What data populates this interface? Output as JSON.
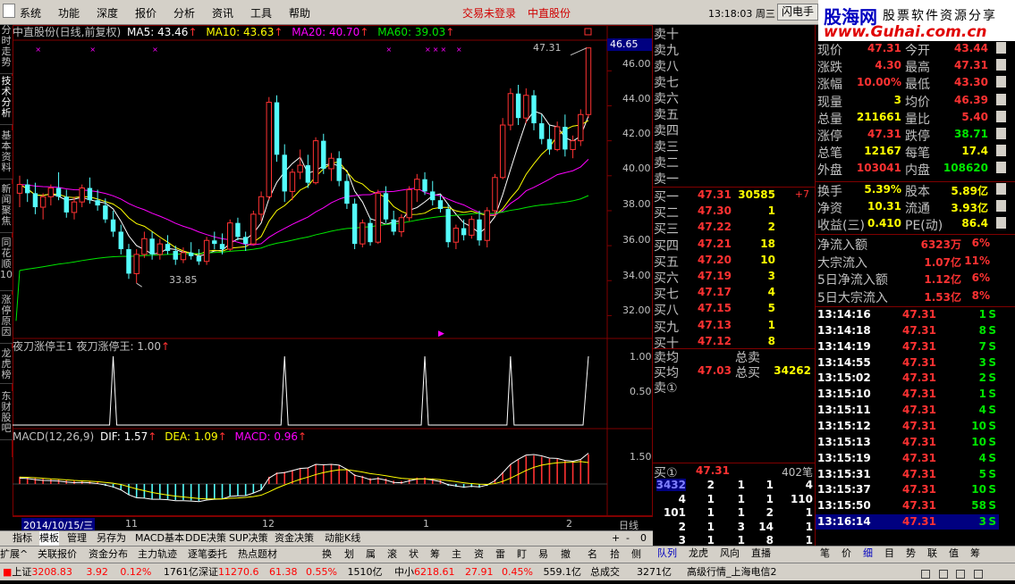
{
  "menu": {
    "items": [
      "系统",
      "功能",
      "深度",
      "报价",
      "分析",
      "资讯",
      "工具",
      "帮助"
    ],
    "status": "交易未登录",
    "stock_title": "中直股份",
    "time": "13:18:03 周三",
    "flash_btn": "闪电手"
  },
  "banner": {
    "logo_text": "股海网",
    "url": "www.Guhai.com.cn",
    "slogan": "股票软件资源分享"
  },
  "side_tabs": [
    "分时走势",
    "技术分析",
    "基本资料",
    "新闻聚焦",
    "同花顺10",
    "涨停原因",
    "龙虎榜",
    "东财股吧"
  ],
  "chart": {
    "header": {
      "name": "中直股份(日线,前复权)",
      "ma5": "MA5: 43.46",
      "ma10": "MA10: 43.63",
      "ma20": "MA20: 40.70",
      "ma60": "MA60: 39.03"
    },
    "price_axis": [
      "46.00",
      "44.00",
      "42.00",
      "40.00",
      "38.00",
      "36.00",
      "34.00",
      "32.00"
    ],
    "current_price_tag": "46.65",
    "high_label": "47.31",
    "low_label": "33.85",
    "ind1_header": "夜刀涨停王1  夜刀涨停王: 1.00",
    "ind1_axis": [
      "1.00",
      "0.50"
    ],
    "macd_header": {
      "name": "MACD(12,26,9)",
      "dif": "DIF: 1.57",
      "dea": "DEA: 1.09",
      "macd": "MACD: 0.96"
    },
    "macd_axis": [
      "1.50"
    ],
    "date_cursor": "2014/10/15/三",
    "months": [
      "11",
      "12",
      "1",
      "2"
    ],
    "period": "日线",
    "candles": [
      [
        39,
        40,
        38.2,
        39.5
      ],
      [
        39.5,
        39.8,
        38.5,
        39
      ],
      [
        39,
        39.6,
        37.8,
        38.2
      ],
      [
        38.2,
        39,
        37.5,
        38.8
      ],
      [
        38.8,
        39.5,
        38.3,
        39.3
      ],
      [
        39.3,
        40.2,
        38.6,
        38.8
      ],
      [
        38.8,
        39.2,
        37.6,
        37.9
      ],
      [
        37.9,
        38.8,
        37.5,
        38.5
      ],
      [
        38.5,
        39.5,
        38.2,
        39.3
      ],
      [
        39.3,
        39.9,
        38.4,
        38.6
      ],
      [
        38.6,
        39.2,
        38,
        38.3
      ],
      [
        38.3,
        38.7,
        37.3,
        37.5
      ],
      [
        37.5,
        38,
        36.5,
        36.8
      ],
      [
        36.8,
        37.2,
        35.5,
        35.8
      ],
      [
        35.8,
        36.1,
        34.1,
        34.4
      ],
      [
        34.4,
        35.8,
        33.85,
        35.5
      ],
      [
        35.5,
        36.8,
        35.3,
        36.4
      ],
      [
        36.4,
        36.8,
        35.2,
        35.5
      ],
      [
        35.5,
        36.4,
        35.2,
        36.1
      ],
      [
        36.1,
        36.6,
        35.5,
        35.7
      ],
      [
        35.7,
        36,
        34.9,
        35.2
      ],
      [
        35.2,
        35.9,
        35,
        35.6
      ],
      [
        35.6,
        36.2,
        35.2,
        35.4
      ],
      [
        35.4,
        35.8,
        34.9,
        35.1
      ],
      [
        35.1,
        36.5,
        34.9,
        36.3
      ],
      [
        36.3,
        36.8,
        35.8,
        36.1
      ],
      [
        36.1,
        36.7,
        35.5,
        35.8
      ],
      [
        35.8,
        37.5,
        35.7,
        37.3
      ],
      [
        37.3,
        37.6,
        36.3,
        36.5
      ],
      [
        36.5,
        36.8,
        35.7,
        36.1
      ],
      [
        36.1,
        38,
        36,
        37.8
      ],
      [
        37.8,
        39.1,
        37.4,
        38.8
      ],
      [
        38.8,
        44.5,
        38.6,
        44.2
      ],
      [
        44.2,
        44.6,
        40.8,
        41.2
      ],
      [
        41.2,
        41.8,
        38.5,
        39.1
      ],
      [
        39.1,
        40.4,
        38.6,
        40.2
      ],
      [
        40.2,
        41.5,
        39.8,
        40.6
      ],
      [
        40.6,
        41.2,
        39.3,
        39.6
      ],
      [
        39.6,
        42.2,
        39.5,
        42
      ],
      [
        42,
        42.4,
        40.1,
        40.4
      ],
      [
        40.4,
        41.3,
        39.7,
        41
      ],
      [
        41,
        41.4,
        39.4,
        39.7
      ],
      [
        39.7,
        40.1,
        38.1,
        38.4
      ],
      [
        38.4,
        38.7,
        35.8,
        36.1
      ],
      [
        36.1,
        37.5,
        35.9,
        37.3
      ],
      [
        37.3,
        37.6,
        36,
        36.2
      ],
      [
        36.2,
        39.2,
        36.1,
        39
      ],
      [
        39,
        39.4,
        37.3,
        37.5
      ],
      [
        37.5,
        38,
        36.6,
        36.8
      ],
      [
        36.8,
        37.8,
        36.5,
        37.6
      ],
      [
        37.6,
        39.4,
        37.4,
        39.2
      ],
      [
        39.2,
        40.1,
        38.5,
        39.8
      ],
      [
        39.8,
        40.2,
        38.9,
        39.1
      ],
      [
        39.1,
        39.7,
        38.3,
        38.6
      ],
      [
        38.6,
        38.9,
        37.9,
        38.1
      ],
      [
        38.1,
        38.4,
        35.9,
        36.2
      ],
      [
        36.2,
        37.2,
        35.8,
        37
      ],
      [
        37,
        37.5,
        36.3,
        36.6
      ],
      [
        36.6,
        37.7,
        36.4,
        37.5
      ],
      [
        37.5,
        38,
        36,
        36.3
      ],
      [
        36.3,
        38.2,
        35.9,
        38
      ],
      [
        38,
        40.1,
        37.7,
        39.9
      ],
      [
        39.9,
        43.3,
        39.8,
        42.9
      ],
      [
        42.9,
        45,
        42.6,
        44.7
      ],
      [
        44.7,
        45.2,
        42.9,
        43.3
      ],
      [
        43.3,
        45,
        43,
        44.6
      ],
      [
        44.6,
        44.9,
        42.6,
        43
      ],
      [
        43,
        43.5,
        41.8,
        42.1
      ],
      [
        42.1,
        42.9,
        41.2,
        41.5
      ],
      [
        41.5,
        43.1,
        41.4,
        42.8
      ],
      [
        42.8,
        43.5,
        41.1,
        41.5
      ],
      [
        41.5,
        42.3,
        41,
        42
      ],
      [
        42,
        43.8,
        41.7,
        43.5
      ],
      [
        43.5,
        47.31,
        43.3,
        47.31
      ]
    ],
    "macd_dif": [
      0.3,
      0.28,
      0.22,
      0.18,
      0.17,
      0.15,
      0.1,
      0.07,
      0.08,
      0.06,
      0.02,
      -0.05,
      -0.15,
      -0.3,
      -0.55,
      -0.7,
      -0.72,
      -0.78,
      -0.78,
      -0.8,
      -0.85,
      -0.85,
      -0.87,
      -0.9,
      -0.82,
      -0.78,
      -0.76,
      -0.63,
      -0.6,
      -0.59,
      -0.46,
      -0.3,
      0.3,
      0.54,
      0.58,
      0.68,
      0.79,
      0.82,
      1.0,
      0.98,
      1.0,
      0.96,
      0.75,
      0.44,
      0.35,
      0.22,
      0.28,
      0.2,
      0.08,
      0.06,
      0.16,
      0.25,
      0.26,
      0.2,
      0.12,
      -0.04,
      -0.1,
      -0.16,
      -0.12,
      -0.15,
      -0.05,
      0.17,
      0.57,
      1.0,
      1.26,
      1.47,
      1.5,
      1.43,
      1.32,
      1.3,
      1.2,
      1.16,
      1.25,
      1.57
    ],
    "macd_dea": [
      0.35,
      0.34,
      0.32,
      0.29,
      0.26,
      0.24,
      0.21,
      0.18,
      0.16,
      0.14,
      0.12,
      0.08,
      0.04,
      -0.03,
      -0.14,
      -0.25,
      -0.34,
      -0.43,
      -0.5,
      -0.56,
      -0.62,
      -0.66,
      -0.7,
      -0.74,
      -0.76,
      -0.76,
      -0.76,
      -0.73,
      -0.71,
      -0.68,
      -0.64,
      -0.57,
      -0.4,
      -0.21,
      -0.05,
      0.1,
      0.24,
      0.35,
      0.48,
      0.58,
      0.66,
      0.72,
      0.73,
      0.67,
      0.61,
      0.53,
      0.48,
      0.42,
      0.35,
      0.29,
      0.26,
      0.26,
      0.26,
      0.25,
      0.22,
      0.17,
      0.12,
      0.06,
      0.02,
      -0.01,
      -0.02,
      0.02,
      0.13,
      0.3,
      0.49,
      0.69,
      0.85,
      0.96,
      1.03,
      1.08,
      1.1,
      1.11,
      1.14,
      1.09
    ],
    "ind1_peaks": [
      12,
      34,
      52,
      63,
      73
    ]
  },
  "quote": {
    "sells": [
      {
        "label": "卖十"
      },
      {
        "label": "卖九"
      },
      {
        "label": "卖八"
      },
      {
        "label": "卖七"
      },
      {
        "label": "卖六"
      },
      {
        "label": "卖五"
      },
      {
        "label": "卖四"
      },
      {
        "label": "卖三"
      },
      {
        "label": "卖二"
      },
      {
        "label": "卖一"
      }
    ],
    "buys": [
      {
        "label": "买一",
        "price": "47.31",
        "vol": "30585",
        "chg": "+7"
      },
      {
        "label": "买二",
        "price": "47.30",
        "vol": "1",
        "chg": ""
      },
      {
        "label": "买三",
        "price": "47.22",
        "vol": "2",
        "chg": ""
      },
      {
        "label": "买四",
        "price": "47.21",
        "vol": "18",
        "chg": ""
      },
      {
        "label": "买五",
        "price": "47.20",
        "vol": "10",
        "chg": ""
      },
      {
        "label": "买六",
        "price": "47.19",
        "vol": "3",
        "chg": ""
      },
      {
        "label": "买七",
        "price": "47.17",
        "vol": "4",
        "chg": ""
      },
      {
        "label": "买八",
        "price": "47.15",
        "vol": "5",
        "chg": ""
      },
      {
        "label": "买九",
        "price": "47.13",
        "vol": "1",
        "chg": ""
      },
      {
        "label": "买十",
        "price": "47.12",
        "vol": "8",
        "chg": ""
      }
    ],
    "avg": {
      "sell_avg": "卖均",
      "total_sell": "总卖",
      "buy_avg": "买均",
      "buy_avg_val": "47.03",
      "total_buy": "总买",
      "total_buy_val": "34262",
      "sell1": "卖①"
    },
    "queue": {
      "label": "买①",
      "price": "47.31",
      "count": "402笔",
      "rows": [
        [
          "3432",
          "2",
          "1",
          "1",
          "4"
        ],
        [
          "4",
          "1",
          "1",
          "1",
          "110"
        ],
        [
          "101",
          "1",
          "1",
          "2",
          "1"
        ],
        [
          "2",
          "1",
          "3",
          "14",
          "1"
        ],
        [
          "3",
          "1",
          "1",
          "8",
          "1"
        ]
      ]
    }
  },
  "stats": [
    [
      "现价",
      "47.31",
      "今开",
      "43.44"
    ],
    [
      "涨跌",
      "4.30",
      "最高",
      "47.31"
    ],
    [
      "涨幅",
      "10.00%",
      "最低",
      "43.30"
    ],
    [
      "现量",
      "3",
      "均价",
      "46.39"
    ],
    [
      "总量",
      "211661",
      "量比",
      "5.40"
    ],
    [
      "涨停",
      "47.31",
      "跌停",
      "38.71"
    ],
    [
      "总笔",
      "12167",
      "每笔",
      "17.4"
    ],
    [
      "外盘",
      "103041",
      "内盘",
      "108620"
    ],
    [
      "换手",
      "5.39%",
      "股本",
      "5.89亿"
    ],
    [
      "净资",
      "10.31",
      "流通",
      "3.93亿"
    ],
    [
      "收益(三)",
      "0.410",
      "PE(动)",
      "86.4"
    ]
  ],
  "flows": [
    [
      "净流入额",
      "6323万",
      "6%"
    ],
    [
      "大宗流入",
      "1.07亿",
      "11%"
    ],
    [
      "5日净流入额",
      "1.12亿",
      "6%"
    ],
    [
      "5日大宗流入",
      "1.53亿",
      "8%"
    ]
  ],
  "ticks": [
    [
      "13:14:16",
      "47.31",
      "1",
      "S"
    ],
    [
      "13:14:18",
      "47.31",
      "8",
      "S"
    ],
    [
      "13:14:19",
      "47.31",
      "7",
      "S"
    ],
    [
      "13:14:55",
      "47.31",
      "3",
      "S"
    ],
    [
      "13:15:02",
      "47.31",
      "2",
      "S"
    ],
    [
      "13:15:10",
      "47.31",
      "1",
      "S"
    ],
    [
      "13:15:11",
      "47.31",
      "4",
      "S"
    ],
    [
      "13:15:12",
      "47.31",
      "10",
      "S"
    ],
    [
      "13:15:13",
      "47.31",
      "10",
      "S"
    ],
    [
      "13:15:19",
      "47.31",
      "4",
      "S"
    ],
    [
      "13:15:31",
      "47.31",
      "5",
      "S"
    ],
    [
      "13:15:37",
      "47.31",
      "10",
      "S"
    ],
    [
      "13:15:50",
      "47.31",
      "58",
      "S"
    ],
    [
      "13:16:14",
      "47.31",
      "3",
      "S"
    ]
  ],
  "toolbar1": [
    "指标",
    "模板",
    "管理",
    "另存为",
    "MACD基本",
    "DDE决策",
    "SUP决策",
    "资金决策",
    "动能K线"
  ],
  "toolbar1_right": [
    "+",
    "-",
    "0"
  ],
  "toolbar2": [
    "扩展^",
    "关联报价",
    "资金分布",
    "主力轨迹",
    "逐笔委托",
    "热点题材",
    "换",
    "划",
    "属",
    "滚",
    "状",
    "筹",
    "主",
    "资",
    "雷",
    "盯",
    "易",
    "撤",
    "名",
    "拾",
    "侧"
  ],
  "right_tabs1": [
    "队列",
    "龙虎",
    "风向",
    "直播"
  ],
  "right_tabs2": [
    "笔",
    "价",
    "细",
    "目",
    "势",
    "联",
    "值",
    "筹"
  ],
  "status": [
    {
      "name": "上证",
      "val": "3208.83",
      "chg": "3.92",
      "pct": "0.12%",
      "amt": "1761亿"
    },
    {
      "name": "深证",
      "val": "11270.6",
      "chg": "61.38",
      "pct": "0.55%",
      "amt": "1510亿"
    },
    {
      "name": "中小",
      "val": "6218.61",
      "chg": "27.91",
      "pct": "0.45%",
      "amt": "559.1亿"
    }
  ],
  "status_right": {
    "label": "总成交",
    "amt": "3271亿",
    "quality": "高级行情_上海电信2"
  },
  "colors": {
    "up": "#ff3232",
    "down": "#54fcfc",
    "ma5": "#ffffff",
    "ma10": "#ffff00",
    "ma20": "#ff00ff",
    "ma60": "#00e600",
    "bg": "#000000",
    "grid": "#800000"
  }
}
